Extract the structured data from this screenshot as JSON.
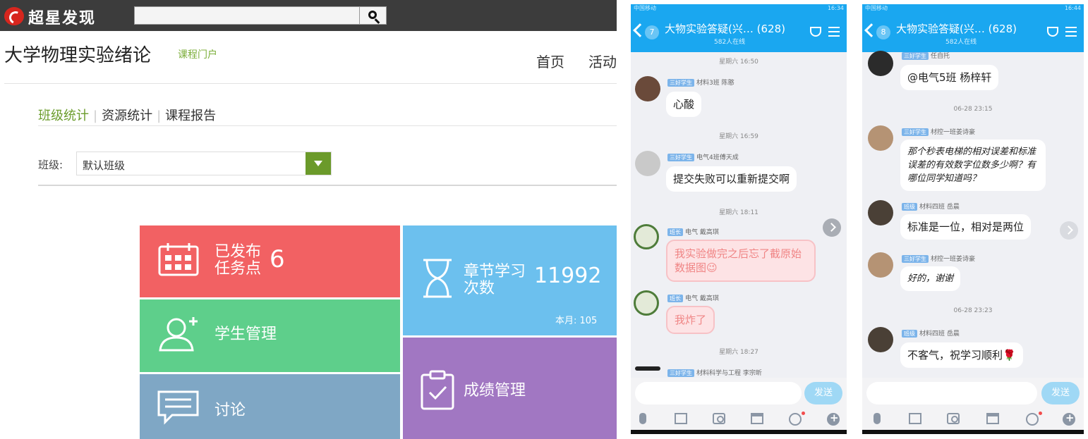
{
  "portal": {
    "brand": "超星发现",
    "search": {
      "placeholder": ""
    },
    "course_title": "大学物理实验绪论",
    "course_portal_link": "课程门户",
    "nav": {
      "home": "首页",
      "activity": "活动"
    },
    "tabs": [
      "班级统计",
      "资源统计",
      "课程报告"
    ],
    "class_label": "班级:",
    "class_select_value": "默认班级",
    "tiles": {
      "published": {
        "label_line1": "已发布",
        "label_line2": "任务点",
        "value": "6",
        "color": "#f26163"
      },
      "chapter": {
        "label_line1": "章节学习",
        "label_line2": "次数",
        "value": "11992",
        "month": "本月: 105",
        "color": "#6cc0ee"
      },
      "students": {
        "label": "学生管理",
        "color": "#5ecf8b"
      },
      "grades": {
        "label": "成绩管理",
        "color": "#a177c2"
      },
      "discussion": {
        "label": "讨论",
        "color": "#7fa7c5"
      }
    }
  },
  "phone1": {
    "status_time": "16:34",
    "carrier": "中国移动",
    "unread": "7",
    "title": "大物实验答疑(兴…",
    "member_count": "(628)",
    "online": "582人在线",
    "messages": [
      {
        "time": "星期六 16:50",
        "role": "三好学生",
        "sender": "材料3班 陈憨",
        "text": "心酸"
      },
      {
        "time": "星期六 16:59",
        "role": "三好学生",
        "sender": "电气4班傅天成",
        "text": "提交失败可以重新提交啊"
      },
      {
        "time": "星期六 18:11",
        "role": "班长",
        "sender": "电气 戴高琪",
        "text": "我实验做完之后忘了截原始数据图😉"
      },
      {
        "role": "班长",
        "sender": "电气 戴高琪",
        "text": "我炸了"
      },
      {
        "time": "星期六 18:27",
        "role": "三好学生",
        "sender": "材料科学与工程 李宗昕"
      }
    ],
    "send": "发送"
  },
  "phone2": {
    "status_time": "16:44",
    "carrier": "中国移动",
    "unread": "8",
    "title": "大物实验答疑(兴…",
    "member_count": "(628)",
    "online": "582人在线",
    "messages": [
      {
        "role": "三好学生",
        "sender": "任自托",
        "text": "@电气5班 杨梓轩"
      },
      {
        "time": "06-28 23:15",
        "role": "三好学生",
        "sender": "材控一班姜诗豪",
        "text": "那个秒表电梯的相对误差和标准误差的有效数字位数多少啊？有哪位同学知道吗？"
      },
      {
        "role": "班级",
        "sender": "材料四班 岳晨",
        "text": "标准是一位，相对是两位"
      },
      {
        "role": "三好学生",
        "sender": "材控一班姜诗豪",
        "text": "好的，谢谢"
      },
      {
        "time": "06-28 23:23",
        "role": "班级",
        "sender": "材料四班 岳晨",
        "text": "不客气，祝学习顺利🌹"
      }
    ],
    "send": "发送"
  },
  "icons": [
    "search-icon",
    "calendar-icon",
    "hourglass-icon",
    "user-add-icon",
    "clipboard-check-icon",
    "chat-icon",
    "microphone-icon",
    "image-icon",
    "camera-icon",
    "folder-icon",
    "emoji-icon",
    "plus-icon"
  ]
}
